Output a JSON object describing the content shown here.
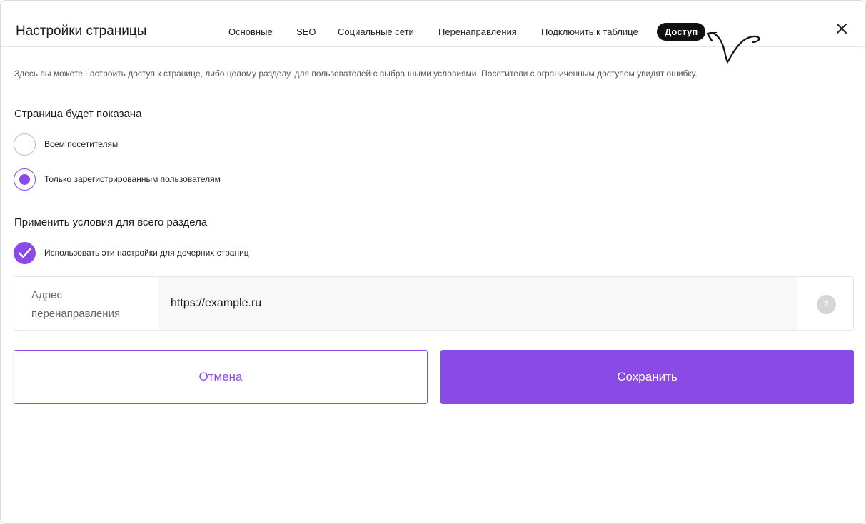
{
  "header": {
    "title": "Настройки страницы",
    "tabs": [
      {
        "label": "Основные"
      },
      {
        "label": "SEO"
      },
      {
        "label": "Социальные сети"
      },
      {
        "label": "Перенаправления"
      },
      {
        "label": "Подключить к таблице"
      },
      {
        "label": "Доступ",
        "active": true
      }
    ],
    "close_icon": "close-icon"
  },
  "description": "Здесь вы можете настроить доступ к странице, либо целому разделу, для пользователей с выбранными условиями. Посетители с ограниченным доступом увидят ошибку.",
  "visibility": {
    "title": "Страница будет показана",
    "options": [
      {
        "label": "Всем посетителям",
        "checked": false
      },
      {
        "label": "Только зарегистрированным пользователям",
        "checked": true
      }
    ]
  },
  "apply_section": {
    "title": "Применить условия для всего раздела",
    "checkbox_label": "Использовать эти настройки для дочерних страниц",
    "checked": true
  },
  "redirect": {
    "label": "Адрес перенаправления",
    "value": "https://example.ru",
    "help": "?"
  },
  "actions": {
    "cancel": "Отмена",
    "save": "Сохранить"
  },
  "colors": {
    "accent": "#8a4ae6",
    "tab_active_bg": "#111111"
  }
}
